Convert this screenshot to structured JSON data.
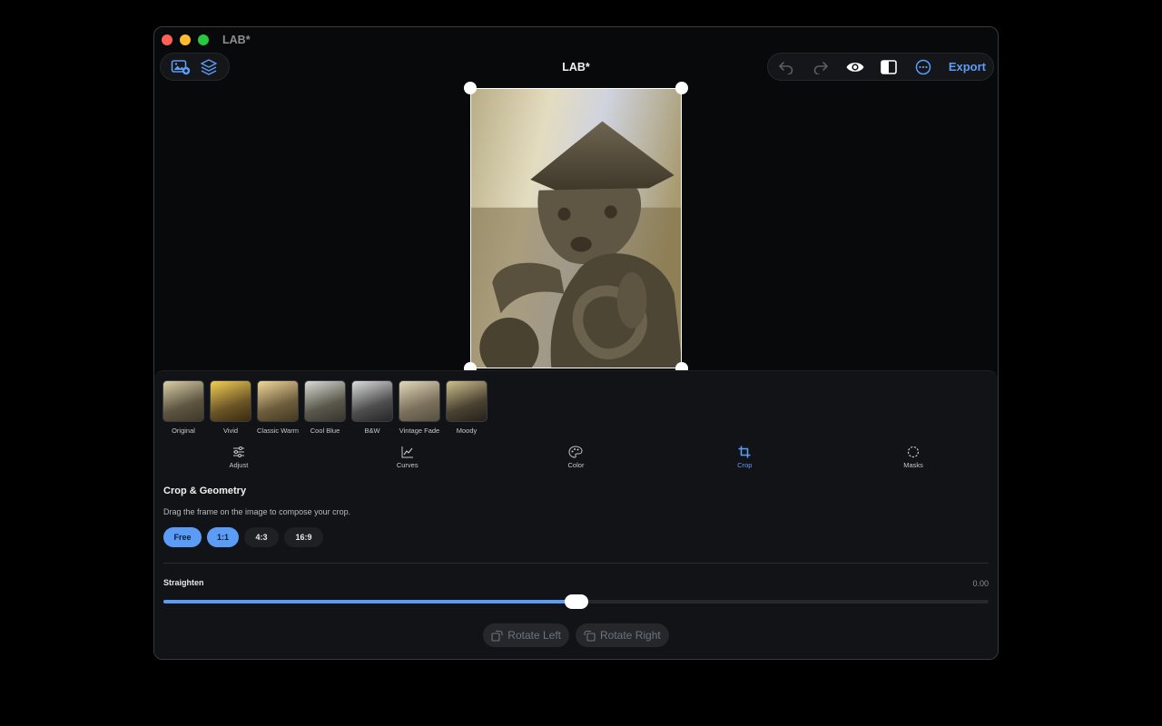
{
  "window": {
    "title": "LAB*"
  },
  "document": {
    "title": "LAB*"
  },
  "toolbar": {
    "left_icons": [
      "add-photo-icon",
      "layers-icon"
    ],
    "right_icons": [
      "undo-icon",
      "redo-icon",
      "eye-icon",
      "compare-icon",
      "more-icon"
    ],
    "export_label": "Export",
    "accent": "#5b9cf6"
  },
  "presets": [
    {
      "label": "Original"
    },
    {
      "label": "Vivid"
    },
    {
      "label": "Classic Warm"
    },
    {
      "label": "Cool Blue"
    },
    {
      "label": "B&W"
    },
    {
      "label": "Vintage Fade"
    },
    {
      "label": "Moody"
    }
  ],
  "tabs": [
    {
      "label": "Adjust",
      "icon": "sliders-icon"
    },
    {
      "label": "Curves",
      "icon": "curves-icon"
    },
    {
      "label": "Color",
      "icon": "palette-icon"
    },
    {
      "label": "Crop",
      "icon": "crop-icon",
      "active": true
    },
    {
      "label": "Masks",
      "icon": "mask-icon"
    }
  ],
  "crop": {
    "title": "Crop & Geometry",
    "hint": "Drag the frame on the image to compose your crop.",
    "ratios": [
      {
        "label": "Free",
        "active": true
      },
      {
        "label": "1:1",
        "active": true
      },
      {
        "label": "4:3"
      },
      {
        "label": "16:9"
      }
    ],
    "straighten": {
      "label": "Straighten",
      "value_text": "0.00",
      "fraction": 0.5
    },
    "rotate_left": "Rotate Left",
    "rotate_right": "Rotate Right"
  }
}
